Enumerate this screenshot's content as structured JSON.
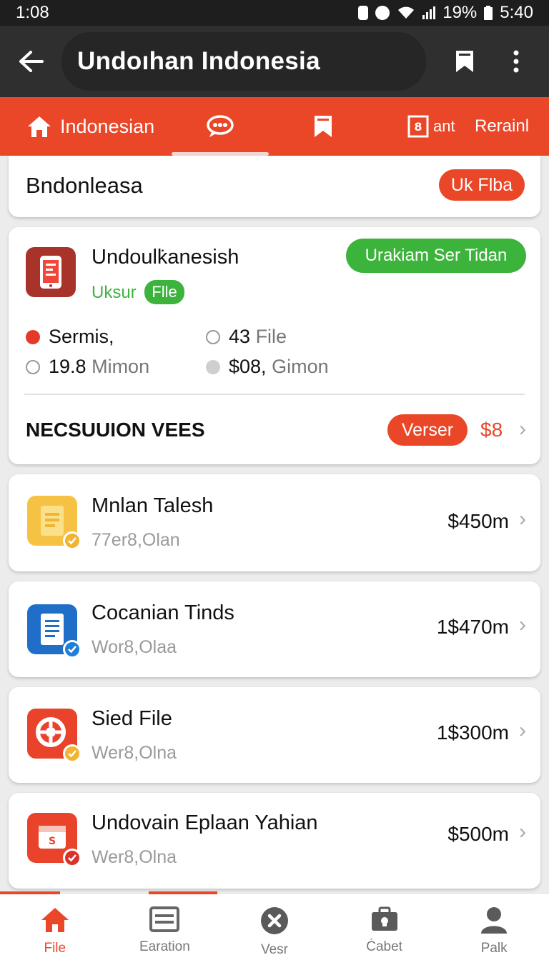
{
  "status_bar": {
    "time_left": "1:08",
    "battery": "19%",
    "time_right": "5:40"
  },
  "app_bar": {
    "title": "Undoıhan Indonesia"
  },
  "tabs": [
    {
      "label": "Indonesian",
      "icon": "home-icon"
    },
    {
      "label": "",
      "icon": "chat-icon"
    },
    {
      "label": "",
      "icon": "bookmark-icon"
    },
    {
      "label": "ant",
      "icon": "box-icon"
    },
    {
      "label": "Rerainl",
      "icon": ""
    }
  ],
  "header_card": {
    "title": "Bndonleasa",
    "badge": "Uk Flba"
  },
  "summary_card": {
    "app_name": "Undoulk̇anesish",
    "subtitle": "Uksur",
    "file_tag": "Flle",
    "action_button": "Urakiam Ser Tidan",
    "stats": [
      {
        "value": "Sermis,",
        "unit": ""
      },
      {
        "value": "43",
        "unit": "File"
      },
      {
        "value": "19.8",
        "unit": "Mimon"
      },
      {
        "value": "$08,",
        "unit": "Gimon"
      }
    ],
    "section_title": "NECSUUION VEES",
    "section_button": "Verser",
    "section_value": "$8"
  },
  "items": [
    {
      "name": "Mnlan Talesh",
      "sub": "77er8,Olan",
      "price": "$450m",
      "icon": "document-icon",
      "color": "#f6c244",
      "check_color": "#f2b331"
    },
    {
      "name": "Cocanian Tinds",
      "sub": "Wor8,Olaa",
      "price": "1$470m",
      "icon": "list-icon",
      "color": "#1f6fc8",
      "check_color": "#1f7fd8"
    },
    {
      "name": "Sied File",
      "sub": "Wer8,Olna",
      "price": "1$300m",
      "icon": "lifebuoy-icon",
      "color": "#e9432b",
      "check_color": "#f2b331"
    },
    {
      "name": "Undovain Eplaan Yahian",
      "sub": "Wer8,Olna",
      "price": "$500m",
      "icon": "calendar-icon",
      "color": "#e9432b",
      "check_color": "#d8332a"
    }
  ],
  "bottom_nav": [
    {
      "label": "File",
      "icon": "home-icon"
    },
    {
      "label": "Earation",
      "icon": "card-icon"
    },
    {
      "label": "Vesr",
      "icon": "close-circle-icon"
    },
    {
      "label": "Ċabet",
      "icon": "briefcase-icon"
    },
    {
      "label": "Palk",
      "icon": "person-icon"
    }
  ],
  "colors": {
    "accent": "#ea4628",
    "green": "#3cb43c",
    "dark_bar": "#2f2f2f"
  }
}
